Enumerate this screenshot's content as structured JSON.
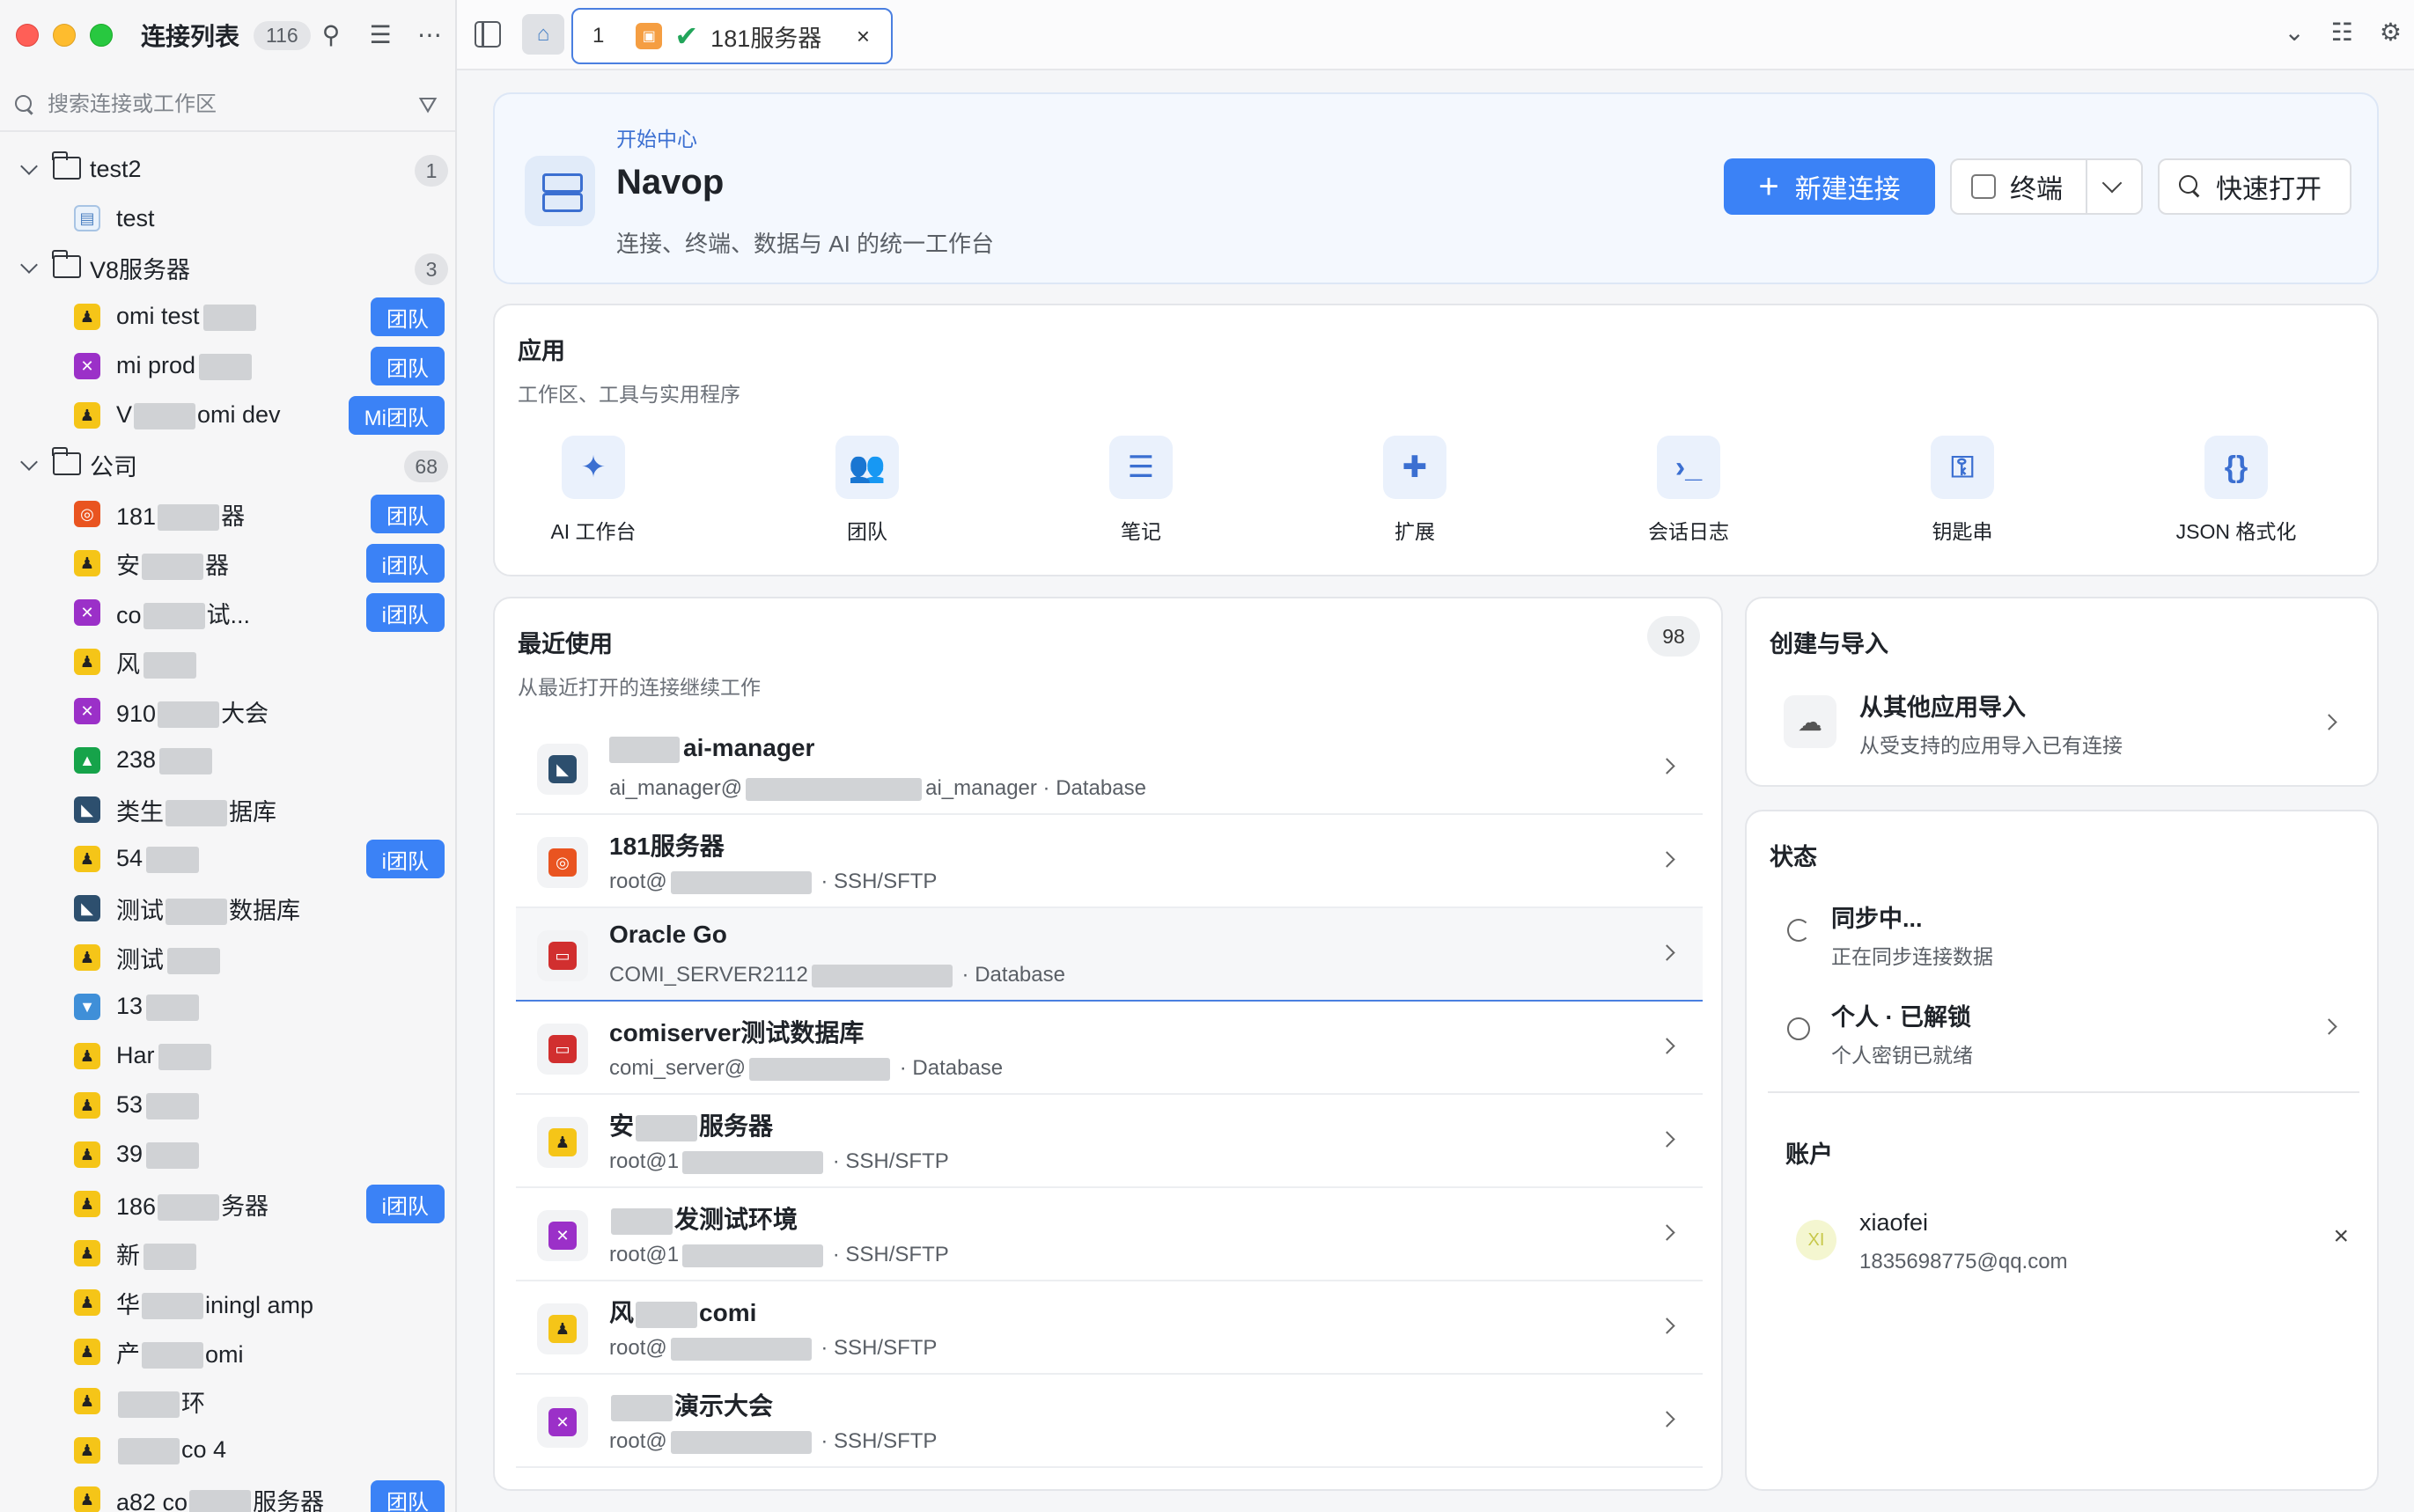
{
  "sidebar": {
    "title": "连接列表",
    "count": "116",
    "search_placeholder": "搜索连接或工作区",
    "groups": [
      {
        "name": "test2",
        "count": "1",
        "items": [
          {
            "icon": "terminal",
            "name": "test",
            "team": ""
          }
        ]
      },
      {
        "name": "V8服务器",
        "count": "3",
        "items": [
          {
            "icon": "linux",
            "name": "omi test",
            "team": "团队"
          },
          {
            "icon": "purple",
            "name": "mi prod",
            "team": "团队"
          },
          {
            "icon": "linux",
            "name": "V",
            "name2": "omi dev",
            "team": "Mi团队"
          }
        ]
      },
      {
        "name": "公司",
        "count": "68",
        "items": [
          {
            "icon": "ubuntu",
            "name": "181",
            "name2": "器",
            "team": "团队"
          },
          {
            "icon": "linux",
            "name": "安",
            "name2": "器",
            "team": "i团队"
          },
          {
            "icon": "purple",
            "name": "co",
            "name2": "试...",
            "team": "i团队"
          },
          {
            "icon": "linux",
            "name": "风",
            "team": ""
          },
          {
            "icon": "purple",
            "name": "910",
            "name2": "大会",
            "team": ""
          },
          {
            "icon": "green",
            "name": "238",
            "team": ""
          },
          {
            "icon": "db",
            "name": "类生",
            "name2": "据库",
            "team": ""
          },
          {
            "icon": "linux",
            "name": "54",
            "team": "i团队"
          },
          {
            "icon": "db",
            "name": "测试",
            "name2": "数据库",
            "team": ""
          },
          {
            "icon": "linux",
            "name": "测试",
            "team": ""
          },
          {
            "icon": "mac",
            "name": "13",
            "team": ""
          },
          {
            "icon": "linux",
            "name": "Har",
            "team": ""
          },
          {
            "icon": "linux",
            "name": "53",
            "team": ""
          },
          {
            "icon": "linux",
            "name": "39",
            "team": ""
          },
          {
            "icon": "linux",
            "name": "186",
            "name2": "务器",
            "team": "i团队"
          },
          {
            "icon": "linux",
            "name": "新",
            "team": ""
          },
          {
            "icon": "linux",
            "name": "华",
            "name2": "iningl amp",
            "team": ""
          },
          {
            "icon": "linux",
            "name": "产",
            "name2": "omi",
            "team": ""
          },
          {
            "icon": "linux",
            "name": "",
            "name2": "环",
            "team": ""
          },
          {
            "icon": "linux",
            "name": "",
            "name2": "co 4",
            "team": ""
          },
          {
            "icon": "linux",
            "name": "a82 co",
            "name2": "服务器",
            "team": "团队"
          }
        ]
      }
    ]
  },
  "topbar": {
    "tab_index": "1",
    "tab_label": "181服务器",
    "tab_close": "×"
  },
  "hero": {
    "kicker": "开始中心",
    "title": "Navop",
    "subtitle": "连接、终端、数据与 AI 的统一工作台",
    "new_connection": "新建连接",
    "terminal": "终端",
    "quick_open": "快速打开"
  },
  "apps": {
    "title": "应用",
    "subtitle": "工作区、工具与实用程序",
    "items": [
      {
        "icon": "sparkle-icon",
        "glyph": "✦",
        "label": "AI 工作台"
      },
      {
        "icon": "team-icon",
        "glyph": "👥",
        "label": "团队"
      },
      {
        "icon": "notes-icon",
        "glyph": "☰",
        "label": "笔记"
      },
      {
        "icon": "puzzle-icon",
        "glyph": "✚",
        "label": "扩展"
      },
      {
        "icon": "session-log-icon",
        "glyph": "›_",
        "label": "会话日志"
      },
      {
        "icon": "key-icon",
        "glyph": "⚿",
        "label": "钥匙串"
      },
      {
        "icon": "json-icon",
        "glyph": "{}",
        "label": "JSON 格式化"
      }
    ]
  },
  "recent": {
    "title": "最近使用",
    "subtitle": "从最近打开的连接继续工作",
    "count": "98",
    "items": [
      {
        "icon": "db",
        "name": "ai-manager",
        "detail_a": "ai_manager@",
        "detail_b": "ai_manager",
        "type": "Database"
      },
      {
        "icon": "ubuntu",
        "name": "181服务器",
        "detail_a": "root@",
        "detail_b": "",
        "type": "SSH/SFTP"
      },
      {
        "icon": "oracle",
        "name": "Oracle Go",
        "detail_a": "COMI_SERVER2112",
        "detail_b": "",
        "type": "Database"
      },
      {
        "icon": "oracle",
        "name": "comiserver测试数据库",
        "detail_a": "comi_server@",
        "detail_b": "",
        "type": "Database"
      },
      {
        "icon": "linux",
        "name": "安",
        "name2": "服务器",
        "detail_a": "root@1",
        "detail_b": "",
        "type": "SSH/SFTP"
      },
      {
        "icon": "purple",
        "name": "",
        "name2": "发测试环境",
        "detail_a": "root@1",
        "detail_b": "",
        "type": "SSH/SFTP"
      },
      {
        "icon": "linux",
        "name": "风",
        "name2": "comi",
        "detail_a": "root@",
        "detail_b": "",
        "type": "SSH/SFTP"
      },
      {
        "icon": "purple",
        "name": "",
        "name2": "演示大会",
        "detail_a": "root@",
        "detail_b": "",
        "type": "SSH/SFTP"
      }
    ]
  },
  "create": {
    "title": "创建与导入",
    "import_title": "从其他应用导入",
    "import_sub": "从受支持的应用导入已有连接"
  },
  "status": {
    "title": "状态",
    "sync_title": "同步中...",
    "sync_sub": "正在同步连接数据",
    "personal_title": "个人 · 已解锁",
    "personal_sub": "个人密钥已就绪",
    "account_title": "账户",
    "avatar": "XI",
    "user": "xiaofei",
    "email": "1835698775@qq.com"
  },
  "colors": {
    "accent": "#3b82f6",
    "tab_border": "#4a7fe0",
    "check": "#22a55a"
  }
}
